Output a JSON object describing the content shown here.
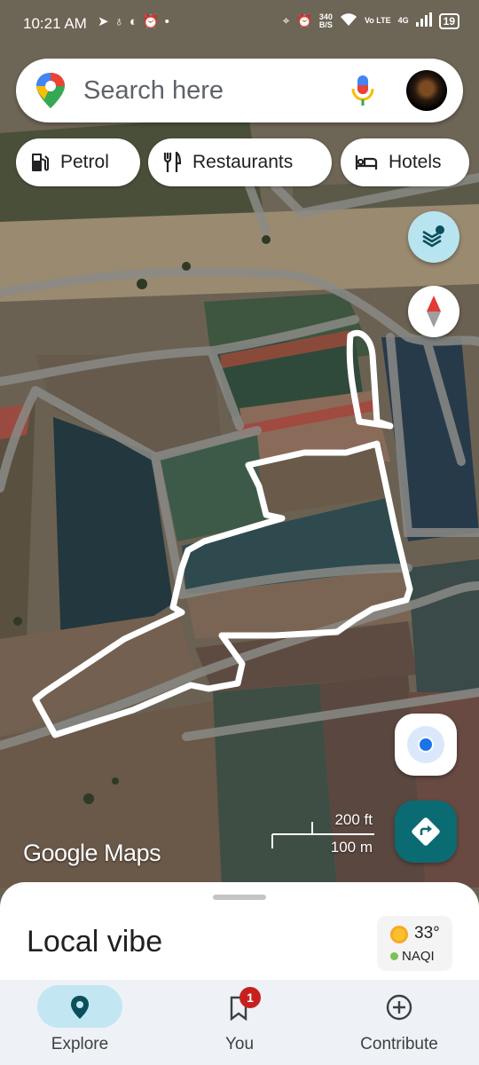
{
  "status_bar": {
    "time": "10:21 AM",
    "left_icons": [
      "telegram-icon",
      "notification-icon",
      "app-icon",
      "alarm-icon",
      "dot-icon"
    ],
    "net_speed_value": "340",
    "net_speed_unit": "B/S",
    "signal_label": "Vo LTE",
    "network_type": "4G",
    "battery": "19"
  },
  "search": {
    "placeholder": "Search here"
  },
  "chips": [
    {
      "label": "Petrol",
      "icon": "fuel-pump-icon"
    },
    {
      "label": "Restaurants",
      "icon": "fork-knife-icon"
    },
    {
      "label": "Hotels",
      "icon": "bed-icon"
    }
  ],
  "map": {
    "watermark": "Google Maps",
    "scale_imperial": "200 ft",
    "scale_metric": "100 m"
  },
  "sheet": {
    "title": "Local vibe",
    "temperature": "33°",
    "aqi_label": "NAQI"
  },
  "nav": {
    "items": [
      {
        "label": "Explore",
        "icon": "location-pin-icon",
        "active": true
      },
      {
        "label": "You",
        "icon": "bookmark-icon",
        "badge": "1"
      },
      {
        "label": "Contribute",
        "icon": "add-circle-icon"
      }
    ]
  },
  "colors": {
    "accent_teal": "#0b6b73",
    "badge_red": "#c5221f",
    "location_blue": "#1a73e8",
    "layers_button_bg": "#b8e4f0"
  }
}
